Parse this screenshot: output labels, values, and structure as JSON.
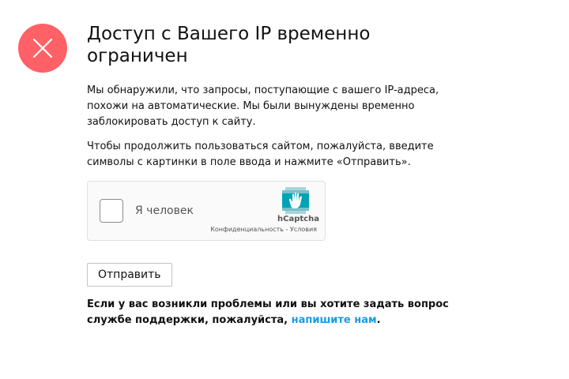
{
  "header": {
    "title": "Доступ с Вашего IP временно ограничен"
  },
  "message": {
    "paragraph_1": "Мы обнаружили, что запросы, поступающие с вашего IP-адреса, похожи на автоматические. Мы были вынуждены временно заблокировать доступ к сайту.",
    "paragraph_2": "Чтобы продолжить пользоваться сайтом, пожалуйста, введите символы с картинки в поле ввода и нажмите «Отправить»."
  },
  "captcha": {
    "checkbox_label": "Я человек",
    "brand": "hCaptcha",
    "privacy_link": "Конфиденциальность",
    "separator": " - ",
    "terms_link": "Условия"
  },
  "form": {
    "submit_label": "Отправить"
  },
  "support": {
    "text_before": "Если у вас возникли проблемы или вы хотите задать вопрос службе поддержки, пожалуйста, ",
    "link_text": "напишите нам",
    "text_after": "."
  },
  "colors": {
    "error_icon_bg": "#ff6166",
    "link": "#1a9be6",
    "captcha_logo": "#00838f"
  },
  "icons": {
    "error": "close-icon",
    "captcha_logo": "hcaptcha-logo-icon"
  }
}
